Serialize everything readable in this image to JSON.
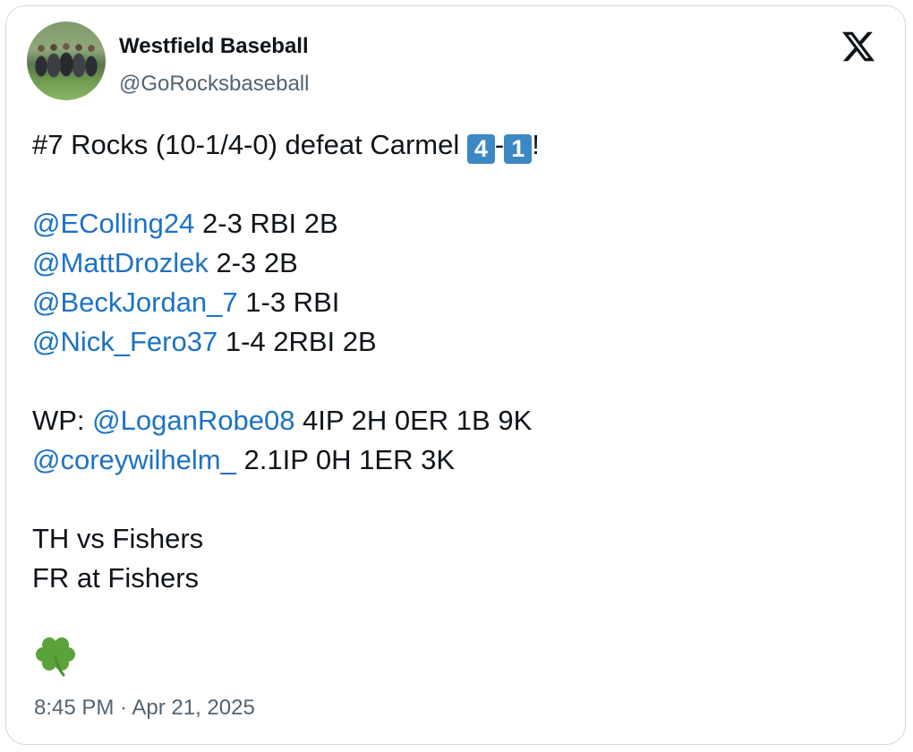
{
  "author": {
    "name": "Westfield Baseball",
    "handle": "@GoRocksbaseball",
    "avatar_icon": "team-photo-avatar"
  },
  "platform_icon": "x-logo-icon",
  "tweet": {
    "headline": {
      "prefix": "#7 Rocks (10-1/4-0) defeat Carmel ",
      "score_home": "4",
      "dash": "-",
      "score_away": "1",
      "suffix": "!"
    },
    "batters": [
      {
        "mention": "@EColling24",
        "stats": " 2-3 RBI 2B"
      },
      {
        "mention": "@MattDrozlek",
        "stats": " 2-3 2B"
      },
      {
        "mention": "@BeckJordan_7",
        "stats": " 1-3 RBI"
      },
      {
        "mention": "@Nick_Fero37",
        "stats": " 1-4 2RBI 2B"
      }
    ],
    "pitchers": {
      "wp_label": "WP: ",
      "winning": {
        "mention": "@LoganRobe08",
        "stats": " 4IP 2H 0ER 1B 9K"
      },
      "relief": {
        "mention": "@coreywilhelm_",
        "stats": " 2.1IP 0H 1ER 3K"
      }
    },
    "schedule": [
      "TH vs Fishers",
      "FR at Fishers"
    ],
    "closing_emoji": "shamrock-icon"
  },
  "timestamp": "8:45 PM · Apr 21, 2025",
  "colors": {
    "mention": "#1d72c4",
    "secondary_text": "#536471",
    "keycap": "#3b88c3",
    "shamrock": "#5aa33a",
    "border": "#cfd9de"
  }
}
